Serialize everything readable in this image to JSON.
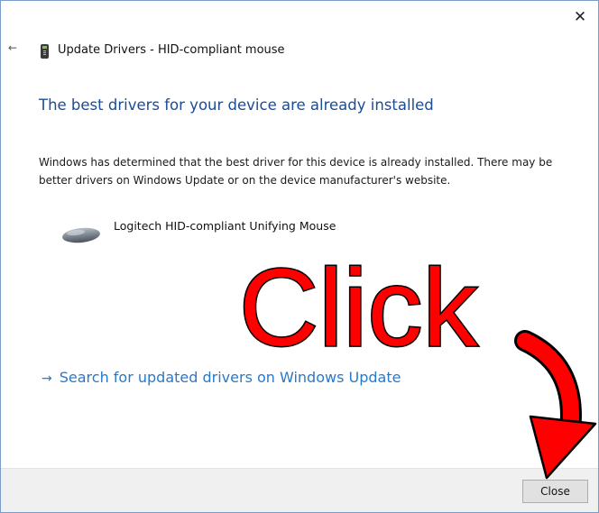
{
  "window": {
    "title": "Update Drivers - HID-compliant mouse",
    "close_glyph": "✕",
    "back_glyph": "←"
  },
  "main": {
    "heading": "The best drivers for your device are already installed",
    "description": "Windows has determined that the best driver for this device is already installed. There may be better drivers on Windows Update or on the device manufacturer's website.",
    "device_name": "Logitech HID-compliant Unifying Mouse",
    "device_icon": "mouse-icon",
    "update_link_arrow": "→",
    "update_link": "Search for updated drivers on Windows Update"
  },
  "footer": {
    "close_label": "Close"
  },
  "annotation": {
    "text": "Click",
    "color": "#ff0000"
  },
  "colors": {
    "heading": "#1a4d96",
    "link": "#2979c9",
    "footer_bg": "#f0f0f0"
  }
}
